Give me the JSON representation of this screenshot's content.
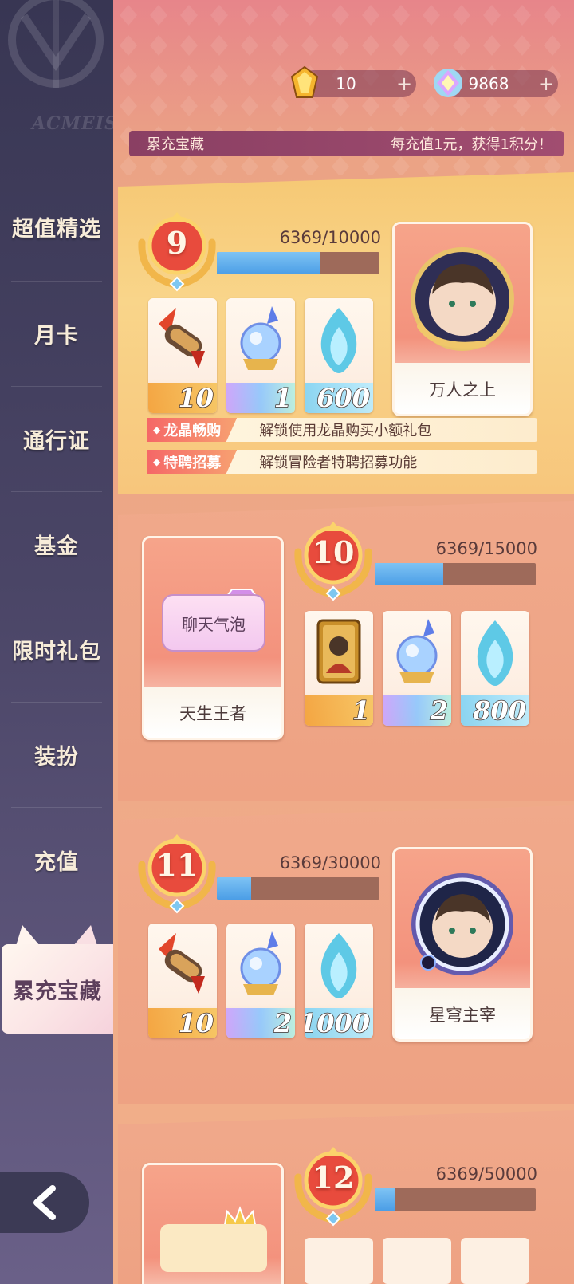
{
  "sidebar": {
    "logo_text": "ACMEIS",
    "items": [
      {
        "label": "超值精选"
      },
      {
        "label": "月卡"
      },
      {
        "label": "通行证"
      },
      {
        "label": "基金"
      },
      {
        "label": "限时礼包"
      },
      {
        "label": "装扮"
      },
      {
        "label": "充值"
      },
      {
        "label": "累充宝藏"
      }
    ],
    "active_item": "累充宝藏"
  },
  "header": {
    "currencies": [
      {
        "icon": "gold-crystal-icon",
        "value": "10",
        "plus": "+"
      },
      {
        "icon": "rainbow-gem-icon",
        "value": "9868",
        "plus": "+"
      }
    ]
  },
  "banner": {
    "title": "累充宝藏",
    "note": "每充值1元，获得1积分！"
  },
  "tiers": [
    {
      "level": "9",
      "progress_text": "6369/10000",
      "progress": 0.6369,
      "items": [
        {
          "icon": "scroll-icon",
          "qty": "10"
        },
        {
          "icon": "crystal-orb-icon",
          "qty": "1"
        },
        {
          "icon": "blue-flame-icon",
          "qty": "600"
        }
      ],
      "reward_name": "万人之上",
      "features": [
        {
          "tag": "龙晶畅购",
          "desc": "解锁使用龙晶购买小额礼包"
        },
        {
          "tag": "特聘招募",
          "desc": "解锁冒险者特聘招募功能"
        }
      ]
    },
    {
      "level": "10",
      "progress_text": "6369/15000",
      "progress": 0.4246,
      "reward_bubble": "聊天气泡",
      "reward_name": "天生王者",
      "items": [
        {
          "icon": "hero-card-icon",
          "qty": "1"
        },
        {
          "icon": "crystal-orb-icon",
          "qty": "2"
        },
        {
          "icon": "blue-flame-icon",
          "qty": "800"
        }
      ]
    },
    {
      "level": "11",
      "progress_text": "6369/30000",
      "progress": 0.2123,
      "items": [
        {
          "icon": "scroll-icon",
          "qty": "10"
        },
        {
          "icon": "crystal-orb-icon",
          "qty": "2"
        },
        {
          "icon": "blue-flame-icon",
          "qty": "1000"
        }
      ],
      "reward_name": "星穹主宰"
    },
    {
      "level": "12",
      "progress_text": "6369/50000",
      "progress": 0.1274
    }
  ]
}
